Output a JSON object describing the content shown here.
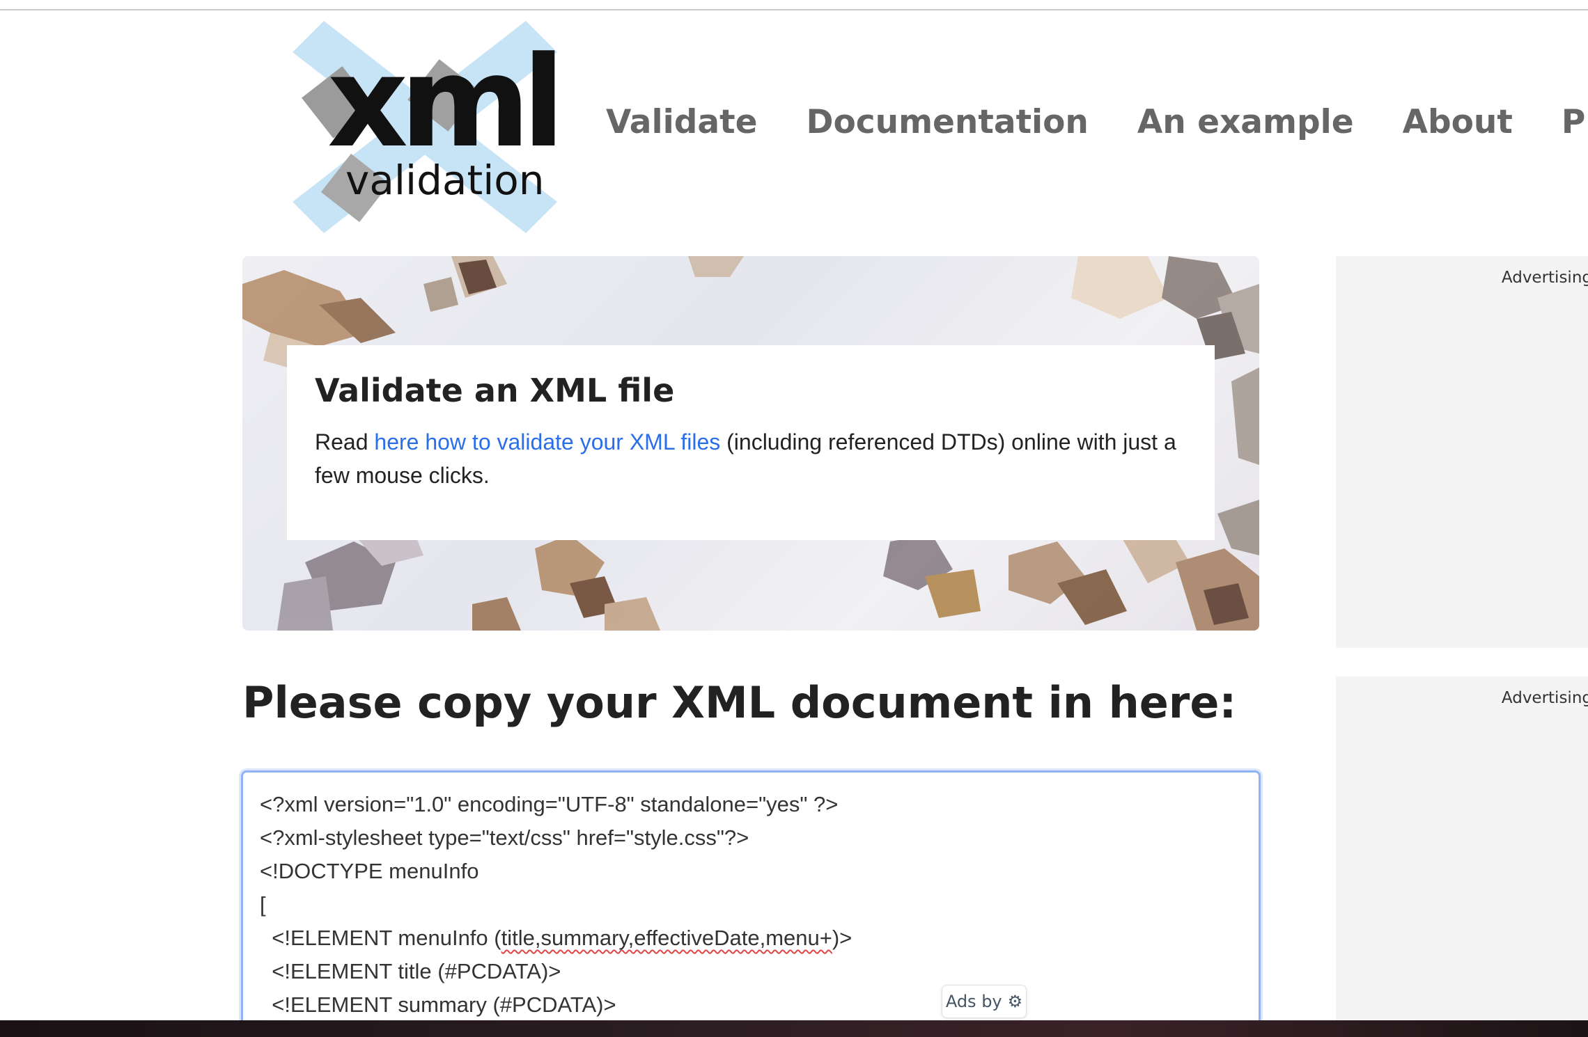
{
  "logo": {
    "main": "xml",
    "sub": "validation"
  },
  "nav": {
    "items": [
      {
        "label": "Validate"
      },
      {
        "label": "Documentation"
      },
      {
        "label": "An example"
      },
      {
        "label": "About"
      },
      {
        "label": "Privacy"
      }
    ]
  },
  "hero": {
    "title": "Validate an XML file",
    "text_before": "Read ",
    "link": "here how to validate your XML files",
    "text_after": " (including referenced DTDs) online with just a few mouse clicks."
  },
  "sidebar": {
    "ad_label_1": "Advertising",
    "ad_label_2": "Advertising"
  },
  "main": {
    "heading": "Please copy your XML document in here:",
    "xml_lines": [
      "<?xml version=\"1.0\" encoding=\"UTF-8\" standalone=\"yes\" ?>",
      "<?xml-stylesheet type=\"text/css\" href=\"style.css\"?>",
      "<!DOCTYPE menuInfo",
      "[",
      "  <!ELEMENT menuInfo (title,summary,effectiveDate,menu+)>",
      "  <!ELEMENT title (#PCDATA)>",
      "  <!ELEMENT summary (#PCDATA)>"
    ]
  },
  "ads_badge": {
    "label": "Ads by",
    "icon": "ads-info-icon"
  },
  "colors": {
    "link": "#2a6ee8",
    "nav": "#666666",
    "focus_border": "#8fb3f5"
  }
}
